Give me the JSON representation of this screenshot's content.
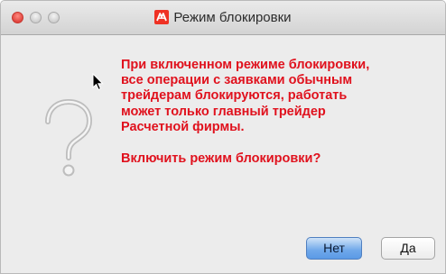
{
  "window": {
    "title": "Режим блокировки",
    "app_icon": "alfa-logo-icon",
    "traffic_lights": [
      "close-icon",
      "minimize-icon",
      "maximize-icon"
    ]
  },
  "dialog": {
    "icon": "question-mark-icon",
    "message_lines": [
      "При включенном режиме блокировки,",
      "все операции с заявками обычным",
      "трейдерам блокируются, работать",
      "может только главный трейдер",
      "Расчетной фирмы."
    ],
    "prompt": "Включить режим блокировки?",
    "message_color": "#e0111d"
  },
  "buttons": {
    "no_label": "Нет",
    "yes_label": "Да"
  },
  "colors": {
    "accent_button": "#6fa8ea",
    "app_icon_red": "#ef3124"
  }
}
